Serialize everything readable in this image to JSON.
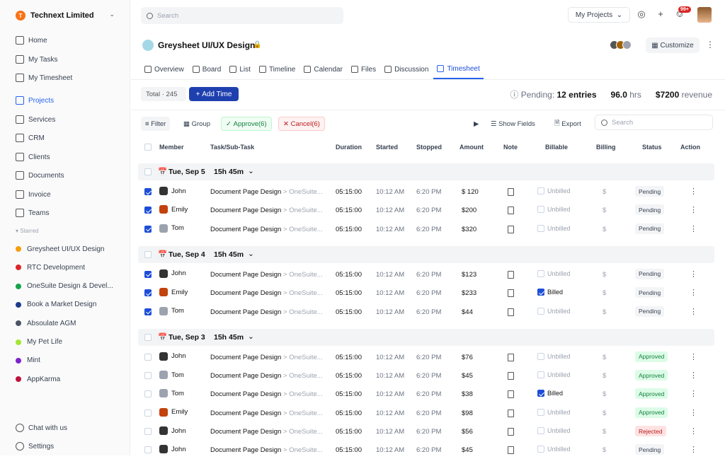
{
  "org": {
    "initial": "T",
    "name": "Technext Limited"
  },
  "nav": [
    {
      "label": "Home",
      "icon": "home-icon"
    },
    {
      "label": "My Tasks",
      "icon": "tasks-icon"
    },
    {
      "label": "My Timesheet",
      "icon": "timesheet-icon"
    },
    {
      "label": "Projects",
      "icon": "projects-icon",
      "active": true
    },
    {
      "label": "Services",
      "icon": "services-icon"
    },
    {
      "label": "CRM",
      "icon": "crm-icon"
    },
    {
      "label": "Clients",
      "icon": "clients-icon"
    },
    {
      "label": "Documents",
      "icon": "documents-icon"
    },
    {
      "label": "Invoice",
      "icon": "invoice-icon"
    },
    {
      "label": "Teams",
      "icon": "teams-icon"
    }
  ],
  "starred_header": "Starred",
  "starred": [
    {
      "label": "Greysheet UI/UX Design",
      "color": "#f59e0b"
    },
    {
      "label": "RTC Development",
      "color": "#dc2626"
    },
    {
      "label": "OneSuite Design & Devel...",
      "color": "#16a34a"
    },
    {
      "label": "Book a Market Design",
      "color": "#1e3a8a"
    },
    {
      "label": "Absoulate AGM",
      "color": "#4b5563"
    },
    {
      "label": "My Pet Life",
      "color": "#a3e635"
    },
    {
      "label": "Mint",
      "color": "#7e22ce"
    },
    {
      "label": "AppKarma",
      "color": "#be123c"
    }
  ],
  "bottom_nav": [
    {
      "label": "Chat with us",
      "icon": "chat-icon"
    },
    {
      "label": "Settings",
      "icon": "settings-icon"
    }
  ],
  "topbar": {
    "search_placeholder": "Search",
    "my_projects": "My Projects",
    "notif_badge": "99+"
  },
  "project": {
    "title": "Greysheet UI/UX Design",
    "customize": "Customize"
  },
  "tabs": [
    {
      "label": "Overview"
    },
    {
      "label": "Board"
    },
    {
      "label": "List"
    },
    {
      "label": "Timeline"
    },
    {
      "label": "Calendar"
    },
    {
      "label": "Files"
    },
    {
      "label": "Discussion"
    },
    {
      "label": "Timesheet",
      "active": true
    }
  ],
  "total_label": "Total · 245",
  "add_time": "Add Time",
  "summary": {
    "pending_label": "Pending:",
    "pending_value": "12 entries",
    "hours_value": "96.0",
    "hours_unit": "hrs",
    "revenue_value": "$7200",
    "revenue_unit": "revenue"
  },
  "toolbar": {
    "filter": "Filter",
    "group": "Group",
    "approve": "Approve(6)",
    "cancel": "Cancel(6)",
    "show_fields": "Show Fields",
    "export": "Export",
    "search_placeholder": "Search"
  },
  "columns": {
    "member": "Member",
    "task": "Task/Sub-Task",
    "duration": "Duration",
    "started": "Started",
    "stopped": "Stopped",
    "amount": "Amount",
    "note": "Note",
    "billable": "Billable",
    "billing": "Billing",
    "status": "Status",
    "action": "Action"
  },
  "groups": [
    {
      "date": "Tue, Sep 5",
      "hours": "15h 45m",
      "rows": [
        {
          "member": "John",
          "task": "Document Page Design",
          "sub": "OneSuite...",
          "duration": "05:15:00",
          "started": "10:12 AM",
          "stopped": "6:20 PM",
          "amount": "$ 120",
          "billable": "Unbilled",
          "billed": false,
          "billing": "$",
          "status": "Pending",
          "checked": true,
          "av": "#333"
        },
        {
          "member": "Emily",
          "task": "Document Page Design",
          "sub": "OneSuite...",
          "duration": "05:15:00",
          "started": "10:12 AM",
          "stopped": "6:20 PM",
          "amount": "$200",
          "billable": "Unbilled",
          "billed": false,
          "billing": "$",
          "status": "Pending",
          "checked": true,
          "av": "#c2410c"
        },
        {
          "member": "Tom",
          "task": "Document Page Design",
          "sub": "OneSuite...",
          "duration": "05:15:00",
          "started": "10:12 AM",
          "stopped": "6:20 PM",
          "amount": "$320",
          "billable": "Unbilled",
          "billed": false,
          "billing": "$",
          "status": "Pending",
          "checked": true,
          "av": "#9ca3af"
        }
      ]
    },
    {
      "date": "Tue, Sep 4",
      "hours": "15h 45m",
      "rows": [
        {
          "member": "John",
          "task": "Document Page Design",
          "sub": "OneSuite...",
          "duration": "05:15:00",
          "started": "10:12 AM",
          "stopped": "6:20 PM",
          "amount": "$123",
          "billable": "Unbilled",
          "billed": false,
          "billing": "$",
          "status": "Pending",
          "checked": true,
          "av": "#333"
        },
        {
          "member": "Emily",
          "task": "Document Page Design",
          "sub": "OneSuite...",
          "duration": "05:15:00",
          "started": "10:12 AM",
          "stopped": "6:20 PM",
          "amount": "$233",
          "billable": "Billed",
          "billed": true,
          "billing": "$",
          "status": "Pending",
          "checked": true,
          "av": "#c2410c"
        },
        {
          "member": "Tom",
          "task": "Document Page Design",
          "sub": "OneSuite...",
          "duration": "05:15:00",
          "started": "10:12 AM",
          "stopped": "6:20 PM",
          "amount": "$44",
          "billable": "Unbilled",
          "billed": false,
          "billing": "$",
          "status": "Pending",
          "checked": true,
          "av": "#9ca3af"
        }
      ]
    },
    {
      "date": "Tue, Sep 3",
      "hours": "15h 45m",
      "rows": [
        {
          "member": "John",
          "task": "Document Page Design",
          "sub": "OneSuite...",
          "duration": "05:15:00",
          "started": "10:12 AM",
          "stopped": "6:20 PM",
          "amount": "$76",
          "billable": "Unbilled",
          "billed": false,
          "billing": "$",
          "status": "Approved",
          "checked": false,
          "av": "#333"
        },
        {
          "member": "Tom",
          "task": "Document Page Design",
          "sub": "OneSuite...",
          "duration": "05:15:00",
          "started": "10:12 AM",
          "stopped": "6:20 PM",
          "amount": "$45",
          "billable": "Unbilled",
          "billed": false,
          "billing": "$",
          "status": "Approved",
          "checked": false,
          "av": "#9ca3af"
        },
        {
          "member": "Tom",
          "task": "Document Page Design",
          "sub": "OneSuite...",
          "duration": "05:15:00",
          "started": "10:12 AM",
          "stopped": "6:20 PM",
          "amount": "$38",
          "billable": "Billed",
          "billed": true,
          "billing": "$",
          "status": "Approved",
          "checked": false,
          "av": "#9ca3af"
        },
        {
          "member": "Emily",
          "task": "Document Page Design",
          "sub": "OneSuite...",
          "duration": "05:15:00",
          "started": "10:12 AM",
          "stopped": "6:20 PM",
          "amount": "$98",
          "billable": "Unbilled",
          "billed": false,
          "billing": "$",
          "status": "Approved",
          "checked": false,
          "av": "#c2410c"
        },
        {
          "member": "John",
          "task": "Document Page Design",
          "sub": "OneSuite...",
          "duration": "05:15:00",
          "started": "10:12 AM",
          "stopped": "6:20 PM",
          "amount": "$56",
          "billable": "Unbilled",
          "billed": false,
          "billing": "$",
          "status": "Rejected",
          "checked": false,
          "av": "#333"
        },
        {
          "member": "John",
          "task": "Document Page Design",
          "sub": "OneSuite...",
          "duration": "05:15:00",
          "started": "10:12 AM",
          "stopped": "6:20 PM",
          "amount": "$45",
          "billable": "Unbilled",
          "billed": false,
          "billing": "$",
          "status": "Pending",
          "checked": false,
          "av": "#333"
        }
      ]
    }
  ]
}
